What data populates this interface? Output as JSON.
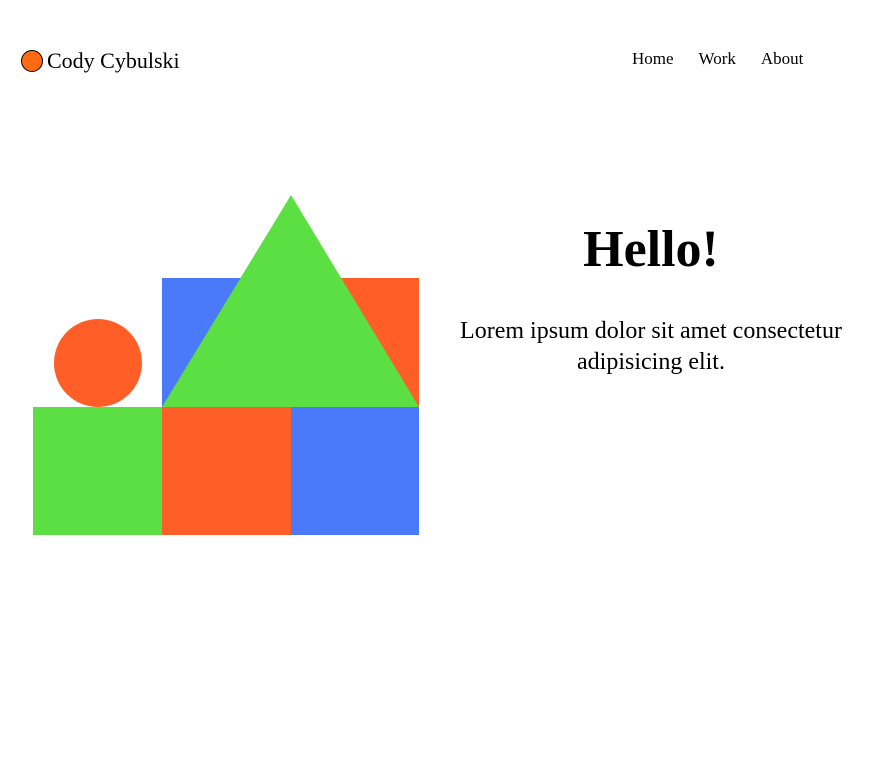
{
  "header": {
    "brand_name": "Cody Cybulski",
    "logo_color": "#ff6a13",
    "nav": [
      {
        "label": "Home"
      },
      {
        "label": "Work"
      },
      {
        "label": "About"
      }
    ]
  },
  "hero": {
    "title": "Hello!",
    "subtitle": "Lorem ipsum dolor sit amet consectetur adipisicing elit.",
    "illustration": {
      "colors": {
        "orange": "#ff5e27",
        "blue": "#4a79fa",
        "green": "#5bdf43"
      }
    }
  }
}
